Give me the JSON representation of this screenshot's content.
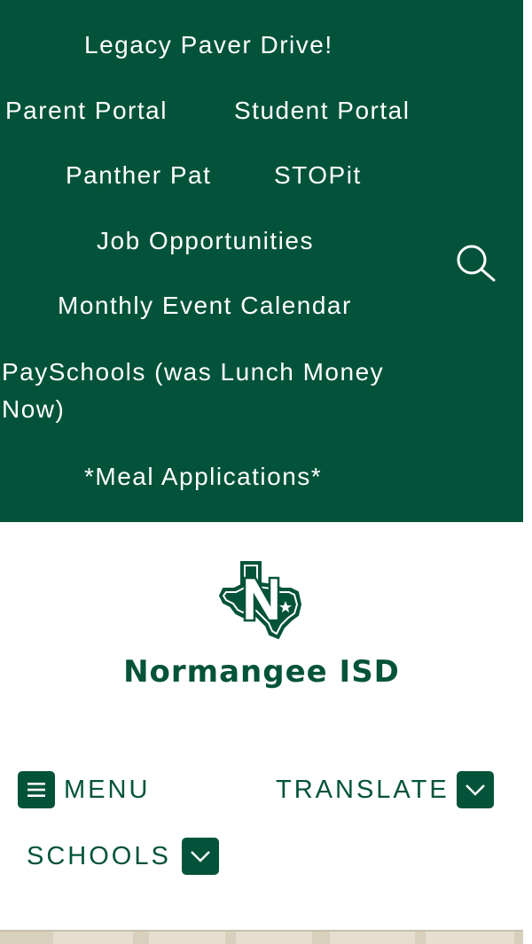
{
  "quick_links": {
    "items": [
      {
        "label": "Legacy Paver Drive!"
      },
      {
        "label": "Parent Portal"
      },
      {
        "label": "Student Portal"
      },
      {
        "label": "Panther Pat"
      },
      {
        "label": "STOPit"
      },
      {
        "label": "Job Opportunities"
      },
      {
        "label": "Monthly Event Calendar"
      },
      {
        "label": "PaySchools (was Lunch Money Now)"
      },
      {
        "label": "*Meal Applications*"
      }
    ],
    "search_icon": "search-icon"
  },
  "header": {
    "district_name": "Normangee ISD",
    "logo_icon": "texas-n-logo"
  },
  "nav": {
    "menu_label": "MENU",
    "translate_label": "TRANSLATE",
    "schools_label": "SCHOOLS",
    "menu_icon": "hamburger-icon",
    "dropdown_icon": "chevron-down-icon"
  },
  "colors": {
    "brand_green": "#03533b",
    "text_on_green": "#ffffff",
    "background": "#ffffff"
  }
}
